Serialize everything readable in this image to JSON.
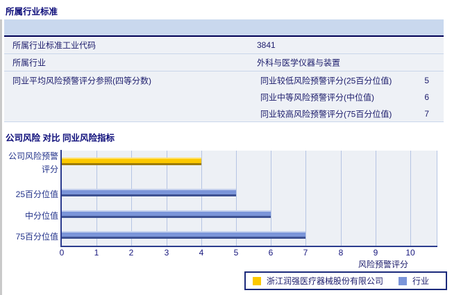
{
  "section1": {
    "title": "所属行业标准"
  },
  "table": {
    "rows": [
      {
        "label": "所属行业标准工业代码",
        "value": "3841"
      },
      {
        "label": "所属行业",
        "value": "外科与医学仪器与装置"
      },
      {
        "label": "同业平均风险预警评分参照(四等分数)",
        "subrows": [
          {
            "label": "同业较低风险预警评分(25百分位值)",
            "value": "5"
          },
          {
            "label": "同业中等风险预警评分(中位值)",
            "value": "6"
          },
          {
            "label": "同业较高风险预警评分(75百分位值)",
            "value": "7"
          }
        ]
      }
    ]
  },
  "section2": {
    "title": "公司风险 对比 同业风险指标"
  },
  "chart_data": {
    "type": "bar",
    "orientation": "horizontal",
    "categories": [
      "公司风险预警评分",
      "25百分位值",
      "中分位值",
      "75百分位值"
    ],
    "bars": [
      {
        "label_lines": [
          "公司风险预警",
          "评分"
        ],
        "value": 4,
        "series": "浙江润强医疗器械股份有限公司"
      },
      {
        "label_lines": [
          "25百分位值"
        ],
        "value": 5,
        "series": "行业"
      },
      {
        "label_lines": [
          "中分位值"
        ],
        "value": 6,
        "series": "行业"
      },
      {
        "label_lines": [
          "75百分位值"
        ],
        "value": 7,
        "series": "行业"
      }
    ],
    "xlabel": "风险预警评分",
    "xlim": [
      0,
      10
    ],
    "xticks": [
      0,
      1,
      2,
      3,
      4,
      5,
      6,
      7,
      8,
      9,
      10
    ],
    "grid": "vertical",
    "legend_position": "bottom",
    "legend": [
      {
        "label": "浙江润强医疗器械股份有限公司",
        "color": "#fcc800"
      },
      {
        "label": "行业",
        "color": "#7b95d9"
      }
    ]
  },
  "colors": {
    "accent_navy": "#0d0d7a",
    "table_header": "#c9d8ee",
    "row_bg": "#eef1f6",
    "company_bar": "#fcc800",
    "industry_bar": "#7b95d9"
  }
}
